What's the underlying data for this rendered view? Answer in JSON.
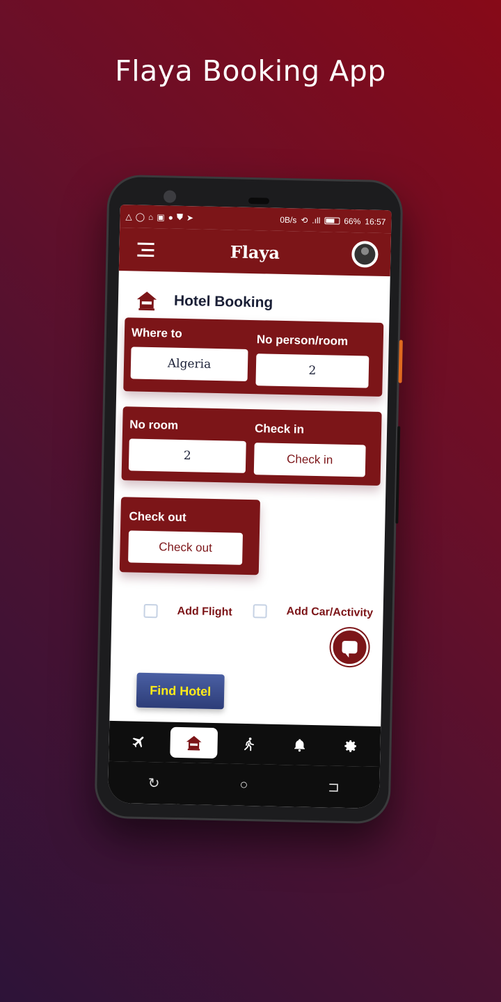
{
  "promo": {
    "title": "Flaya Booking App"
  },
  "status_bar": {
    "left_icons": [
      "warning-icon",
      "whatsapp-icon",
      "shirt-icon",
      "cast-icon",
      "circle-icon",
      "shield-icon",
      "telegram-icon"
    ],
    "net_speed": "0B/s",
    "battery": "66%",
    "battery_level": 0.66,
    "time": "16:57"
  },
  "app_bar": {
    "title": "Flaya"
  },
  "section": {
    "title": "Hotel Booking"
  },
  "form": {
    "where_to": {
      "label": "Where to",
      "value": "Algeria"
    },
    "persons": {
      "label": "No person/room",
      "value": "2"
    },
    "rooms": {
      "label": "No room",
      "value": "2"
    },
    "check_in": {
      "label": "Check in",
      "placeholder": "Check in"
    },
    "check_out": {
      "label": "Check out",
      "placeholder": "Check out"
    }
  },
  "options": {
    "add_flight": {
      "label": "Add Flight",
      "checked": false
    },
    "add_car": {
      "label": "Add Car/Activity",
      "checked": false
    }
  },
  "actions": {
    "find": "Find Hotel"
  },
  "nav": {
    "items": [
      {
        "icon": "plane-icon",
        "active": false
      },
      {
        "icon": "hotel-icon",
        "active": true
      },
      {
        "icon": "activity-icon",
        "active": false
      },
      {
        "icon": "bell-icon",
        "active": false
      },
      {
        "icon": "gear-icon",
        "active": false
      }
    ]
  },
  "colors": {
    "primary": "#7c1518",
    "button": "#2d3d78",
    "button_text": "#ffeb1a"
  }
}
